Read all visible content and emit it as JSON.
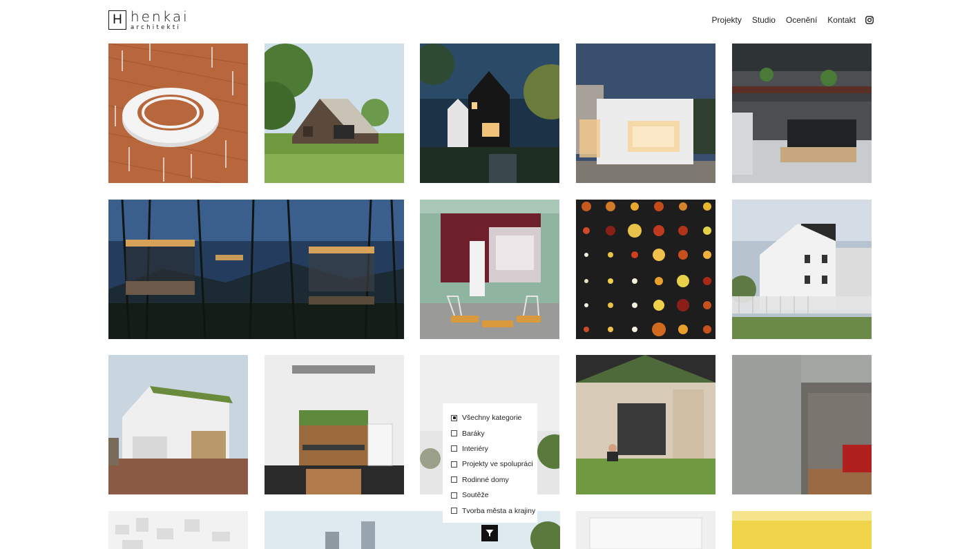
{
  "logo": {
    "letter": "H",
    "name": "henkai",
    "sub": "architekti"
  },
  "nav": {
    "items": [
      {
        "label": "Projekty"
      },
      {
        "label": "Studio"
      },
      {
        "label": "Ocenění"
      },
      {
        "label": "Kontakt"
      }
    ],
    "instagram_icon": "instagram-icon"
  },
  "filter": {
    "items": [
      {
        "label": "Všechny kategorie",
        "checked": true
      },
      {
        "label": "Baráky",
        "checked": false
      },
      {
        "label": "Interiéry",
        "checked": false
      },
      {
        "label": "Projekty ve spolupráci",
        "checked": false
      },
      {
        "label": "Rodinné domy",
        "checked": false
      },
      {
        "label": "Soutěže",
        "checked": false
      },
      {
        "label": "Tvorba města a krajiny",
        "checked": false
      }
    ],
    "button_icon": "filter-funnel-icon"
  },
  "projects": [
    {
      "name": "project-ring-pavilion",
      "image": "ring-pavilion-on-terracotta-ground"
    },
    {
      "name": "project-wooden-barn-house",
      "image": "wooden-gable-house-in-meadow"
    },
    {
      "name": "project-black-house-night",
      "image": "black-gable-house-at-night"
    },
    {
      "name": "project-white-cube-pavilion",
      "image": "white-cube-pavilion-at-dusk"
    },
    {
      "name": "project-industrial-interior",
      "image": "industrial-loft-interior"
    },
    {
      "name": "project-forest-cabins",
      "image": "treehouse-cabins-in-forest-night"
    },
    {
      "name": "project-u-dolejsich",
      "image": "u-dolejsich-shopfront"
    },
    {
      "name": "project-colored-lights",
      "image": "glass-discs-on-black-wall"
    },
    {
      "name": "project-white-villa",
      "image": "white-villa-with-fence"
    },
    {
      "name": "project-green-roof-house",
      "image": "white-house-with-green-roof"
    },
    {
      "name": "project-kitchen-interior",
      "image": "wooden-kitchen-with-plants"
    },
    {
      "name": "project-landscape",
      "image": "hazy-landscape"
    },
    {
      "name": "project-garden-house",
      "image": "house-with-garden-and-yoga"
    },
    {
      "name": "project-concrete-interior",
      "image": "concrete-interior-with-red-sofa"
    },
    {
      "name": "project-city-model",
      "image": "white-city-massing-model"
    },
    {
      "name": "project-towers",
      "image": "high-rise-towers"
    },
    {
      "name": "project-white-room",
      "image": "white-room-interior"
    },
    {
      "name": "project-yellow",
      "image": "yellow-watercolor"
    }
  ]
}
